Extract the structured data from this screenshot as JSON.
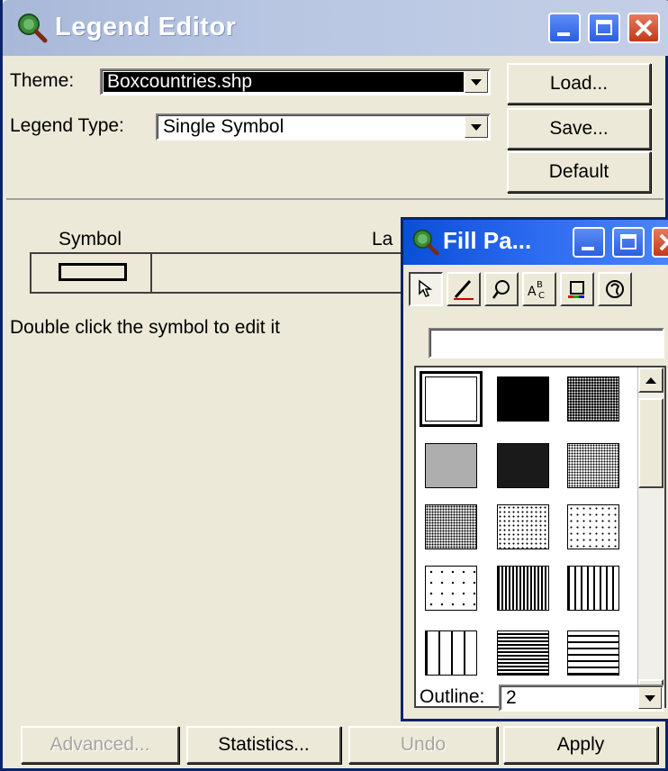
{
  "window": {
    "title": "Legend Editor"
  },
  "theme": {
    "label": "Theme:",
    "value": "Boxcountries.shp"
  },
  "legend_type": {
    "label": "Legend Type:",
    "value": "Single Symbol"
  },
  "side_buttons": {
    "load": "Load...",
    "save": "Save...",
    "default": "Default"
  },
  "table": {
    "col_symbol": "Symbol",
    "col_label": "La"
  },
  "hint": "Double click the symbol to edit it",
  "bottom_buttons": {
    "advanced": "Advanced...",
    "statistics": "Statistics...",
    "undo": "Undo",
    "apply": "Apply"
  },
  "palette": {
    "title": "Fill Pa...",
    "tools": [
      "fill-tool-icon",
      "pen-icon",
      "marker-icon",
      "text-font-icon",
      "color-icon",
      "palette-manager-icon"
    ],
    "outline_label": "Outline:",
    "outline_value": "2",
    "swatches": [
      {
        "pattern": "hollow",
        "selected": true
      },
      {
        "pattern": "solid-black"
      },
      {
        "pattern": "dense-dots"
      },
      {
        "pattern": "heavy-dots"
      },
      {
        "pattern": "medium-dots"
      },
      {
        "pattern": "fine-dots"
      },
      {
        "pattern": "light-dots"
      },
      {
        "pattern": "sparse-dots"
      },
      {
        "pattern": "very-sparse-dots"
      },
      {
        "pattern": "grid-dots"
      },
      {
        "pattern": "dense-vertical-lines"
      },
      {
        "pattern": "vertical-lines"
      },
      {
        "pattern": "wide-vertical-lines"
      },
      {
        "pattern": "dense-horizontal-lines"
      },
      {
        "pattern": "horizontal-lines"
      }
    ]
  },
  "colors": {
    "window_bg": "#ece9d8",
    "theme_highlight": "#000000",
    "active_title": "#2d6bf0",
    "inactive_title": "#b8c6e2"
  }
}
